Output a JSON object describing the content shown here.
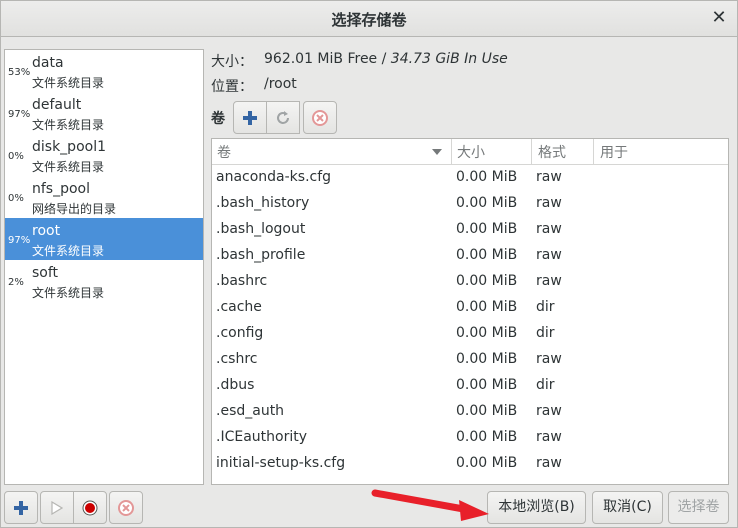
{
  "window": {
    "title": "选择存储卷"
  },
  "pools": [
    {
      "pct": "53%",
      "name": "data",
      "type": "文件系统目录",
      "selected": false
    },
    {
      "pct": "97%",
      "name": "default",
      "type": "文件系统目录",
      "selected": false
    },
    {
      "pct": "0%",
      "name": "disk_pool1",
      "type": "文件系统目录",
      "selected": false
    },
    {
      "pct": "0%",
      "name": "nfs_pool",
      "type": "网络导出的目录",
      "selected": false
    },
    {
      "pct": "97%",
      "name": "root",
      "type": "文件系统目录",
      "selected": true
    },
    {
      "pct": "2%",
      "name": "soft",
      "type": "文件系统目录",
      "selected": false
    }
  ],
  "info": {
    "size_label": "大小：",
    "free": "962.01 MiB Free",
    "slash": " / ",
    "in_use": "34.73 GiB In Use",
    "location_label": "位置：",
    "location": "/root"
  },
  "volumes_label": "卷",
  "table": {
    "columns": [
      "卷",
      "大小",
      "格式",
      "用于"
    ],
    "rows": [
      [
        "anaconda-ks.cfg",
        "0.00 MiB",
        "raw"
      ],
      [
        ".bash_history",
        "0.00 MiB",
        "raw"
      ],
      [
        ".bash_logout",
        "0.00 MiB",
        "raw"
      ],
      [
        ".bash_profile",
        "0.00 MiB",
        "raw"
      ],
      [
        ".bashrc",
        "0.00 MiB",
        "raw"
      ],
      [
        ".cache",
        "0.00 MiB",
        "dir"
      ],
      [
        ".config",
        "0.00 MiB",
        "dir"
      ],
      [
        ".cshrc",
        "0.00 MiB",
        "raw"
      ],
      [
        ".dbus",
        "0.00 MiB",
        "dir"
      ],
      [
        ".esd_auth",
        "0.00 MiB",
        "raw"
      ],
      [
        ".ICEauthority",
        "0.00 MiB",
        "raw"
      ],
      [
        "initial-setup-ks.cfg",
        "0.00 MiB",
        "raw"
      ]
    ]
  },
  "buttons": {
    "browse_local": "本地浏览(B)",
    "cancel": "取消(C)",
    "choose_volume": "选择卷"
  },
  "colors": {
    "selection": "#4a90d9",
    "add": "#3465a4",
    "stop": "#cc0000",
    "arrow": "#e8202a"
  },
  "icons": {
    "close": "close-icon",
    "add": "add-icon",
    "refresh": "refresh-icon",
    "delete": "delete-icon",
    "play": "play-icon",
    "stop": "stop-icon"
  }
}
